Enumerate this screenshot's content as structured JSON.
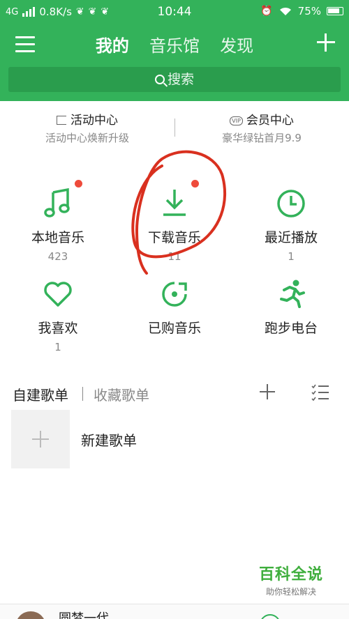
{
  "status_bar": {
    "network": "4G",
    "speed": "0.8K/s",
    "time": "10:44",
    "battery": "75%"
  },
  "nav": {
    "tabs": [
      {
        "label": "我的",
        "active": true
      },
      {
        "label": "音乐馆",
        "active": false
      },
      {
        "label": "发现",
        "active": false
      }
    ]
  },
  "search": {
    "label": "搜索"
  },
  "centers": [
    {
      "title": "活动中心",
      "subtitle": "活动中心焕新升级",
      "icon": "flag-icon"
    },
    {
      "title": "会员中心",
      "subtitle": "豪华绿钻首月9.9",
      "icon": "vip-icon",
      "badge_text": "VIP"
    }
  ],
  "grid": [
    {
      "label": "本地音乐",
      "count": "423",
      "icon": "music-note-icon",
      "red_dot": true
    },
    {
      "label": "下载音乐",
      "count": "11",
      "icon": "download-icon",
      "red_dot": true
    },
    {
      "label": "最近播放",
      "count": "1",
      "icon": "clock-icon",
      "red_dot": false
    },
    {
      "label": "我喜欢",
      "count": "1",
      "icon": "heart-icon",
      "red_dot": false
    },
    {
      "label": "已购音乐",
      "count": "",
      "icon": "purchased-disc-icon",
      "red_dot": false
    },
    {
      "label": "跑步电台",
      "count": "",
      "icon": "running-icon",
      "red_dot": false
    }
  ],
  "playlists": {
    "tab_created": "自建歌单",
    "tab_collected": "收藏歌单",
    "new_playlist": "新建歌单"
  },
  "player": {
    "song": "圆梦一代"
  },
  "watermark": {
    "brand": "百科全说",
    "slogan": "助你轻松解决"
  },
  "colors": {
    "primary_green": "#33b25a",
    "red_dot": "#ee4b3b",
    "annotation_red": "#d9301f"
  }
}
